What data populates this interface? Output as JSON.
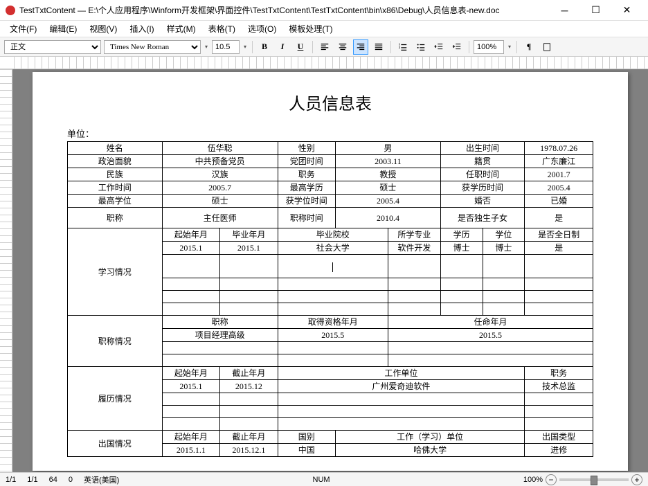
{
  "window": {
    "title": "TestTxtContent — E:\\个人应用程序\\Winform开发框架\\界面控件\\TestTxtContent\\TestTxtContent\\bin\\x86\\Debug\\人员信息表-new.doc"
  },
  "menu": {
    "file": "文件(F)",
    "edit": "编辑(E)",
    "view": "视图(V)",
    "insert": "插入(I)",
    "format": "样式(M)",
    "table": "表格(T)",
    "options": "选项(O)",
    "template": "模板处理(T)"
  },
  "toolbar": {
    "style": "正文",
    "font": "Times New Roman",
    "size": "10.5",
    "zoom": "100%"
  },
  "doc": {
    "title": "人员信息表",
    "unit_label": "单位：",
    "row1": {
      "name_l": "姓名",
      "name": "伍华聪",
      "sex_l": "性别",
      "sex": "男",
      "birth_l": "出生时间",
      "birth": "1978.07.26"
    },
    "row2": {
      "pol_l": "政治面貌",
      "pol": "中共预备党员",
      "party_l": "党团时间",
      "party": "2003.11",
      "origin_l": "籍贯",
      "origin": "广东廉江"
    },
    "row3": {
      "eth_l": "民族",
      "eth": "汉族",
      "duty_l": "职务",
      "duty": "教授",
      "since_l": "任职时间",
      "since": "2001.7"
    },
    "row4": {
      "work_l": "工作时间",
      "work": "2005.7",
      "edu_l": "最高学历",
      "edu": "硕士",
      "edut_l": "获学历时间",
      "edut": "2005.4"
    },
    "row5": {
      "deg_l": "最高学位",
      "deg": "硕士",
      "degt_l": "获学位时间",
      "degt": "2005.4",
      "marry_l": "婚否",
      "marry": "已婚"
    },
    "row6": {
      "title_l": "职称",
      "title": "主任医师",
      "titlet_l": "职称时间",
      "titlet": "2010.4",
      "only_l": "是否独生子女",
      "only": "是"
    },
    "study": {
      "label": "学习情况",
      "hdr": {
        "start": "起始年月",
        "end": "毕业年月",
        "school": "毕业院校",
        "major": "所学专业",
        "edu": "学历",
        "deg": "学位",
        "ft": "是否全日制"
      },
      "r1": {
        "start": "2015.1",
        "end": "2015.1",
        "school": "社会大学",
        "major": "软件开发",
        "edu": "博士",
        "deg": "博士",
        "ft": "是"
      }
    },
    "jobtitle": {
      "label": "职称情况",
      "hdr": {
        "name": "职称",
        "qual": "取得资格年月",
        "appoint": "任命年月"
      },
      "r1": {
        "name": "项目经理高级",
        "qual": "2015.5",
        "appoint": "2015.5"
      }
    },
    "resume": {
      "label": "履历情况",
      "hdr": {
        "start": "起始年月",
        "end": "截止年月",
        "unit": "工作单位",
        "duty": "职务"
      },
      "r1": {
        "start": "2015.1",
        "end": "2015.12",
        "unit": "广州爱奇迪软件",
        "duty": "技术总监"
      }
    },
    "abroad": {
      "label": "出国情况",
      "hdr": {
        "start": "起始年月",
        "end": "截止年月",
        "country": "国别",
        "unit": "工作（学习）单位",
        "type": "出国类型"
      },
      "r1": {
        "start": "2015.1.1",
        "end": "2015.12.1",
        "country": "中国",
        "unit": "哈佛大学",
        "type": "进修"
      }
    }
  },
  "status": {
    "page": "1/1",
    "line": "1/1",
    "col": "64",
    "caps": "0",
    "lang": "英语(美国)",
    "num": "NUM",
    "zoom": "100%"
  }
}
